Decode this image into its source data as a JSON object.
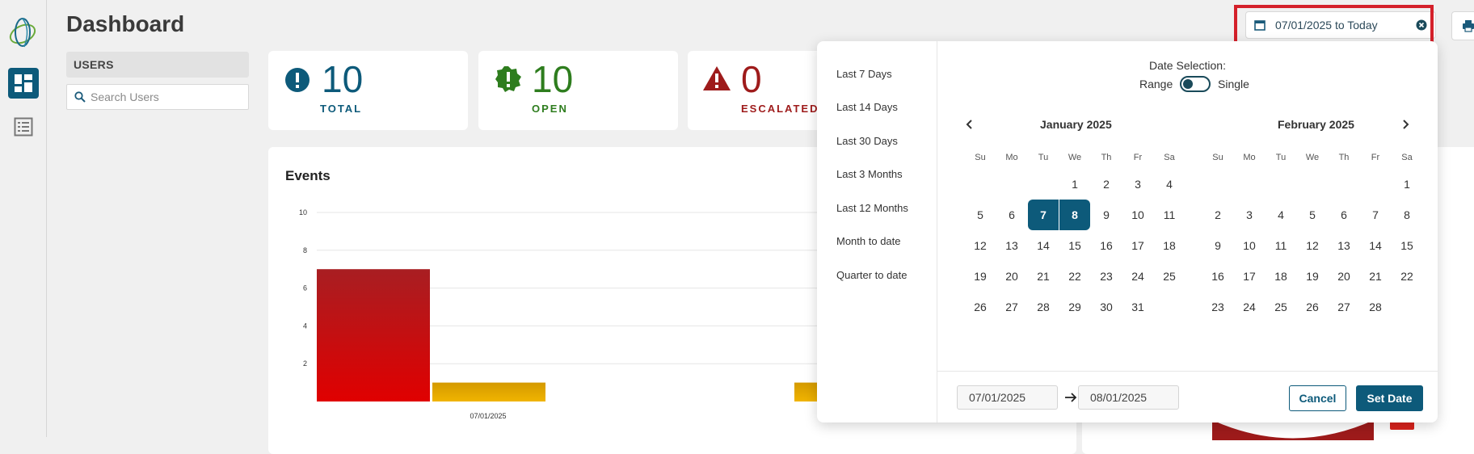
{
  "header": {
    "title": "Dashboard",
    "date_range": "07/01/2025 to Today"
  },
  "users": {
    "heading": "USERS",
    "search_placeholder": "Search Users"
  },
  "stats": [
    {
      "value": "10",
      "label": "TOTAL",
      "color": "#0d5a7a"
    },
    {
      "value": "10",
      "label": "OPEN",
      "color": "#2e7d1e"
    },
    {
      "value": "0",
      "label": "ESCALATED",
      "color": "#9e1b1b"
    }
  ],
  "events": {
    "title": "Events"
  },
  "chart_data": {
    "type": "bar",
    "title": "Events",
    "x": [
      "07/01/2025"
    ],
    "series": [
      {
        "values": [
          7
        ],
        "color": "#d40d0d"
      },
      {
        "values": [
          1
        ],
        "color": "#e8a800"
      },
      {
        "values": [
          1
        ],
        "color": "#e8a800"
      }
    ],
    "y_ticks": [
      "2",
      "4",
      "6",
      "8",
      "10"
    ],
    "ylim": [
      0,
      10
    ],
    "grid": true
  },
  "popup": {
    "presets": [
      "Last 7 Days",
      "Last 14 Days",
      "Last 30 Days",
      "Last 3 Months",
      "Last 12 Months",
      "Month to date",
      "Quarter to date"
    ],
    "selection_title": "Date Selection:",
    "range_label": "Range",
    "single_label": "Single",
    "weekdays": [
      "Su",
      "Mo",
      "Tu",
      "We",
      "Th",
      "Fr",
      "Sa"
    ],
    "months": [
      {
        "name": "January 2025",
        "start_offset": 3,
        "days": 31,
        "selected": [
          7,
          8
        ]
      },
      {
        "name": "February 2025",
        "start_offset": 6,
        "days": 28,
        "selected": []
      }
    ],
    "from_date": "07/01/2025",
    "to_date": "08/01/2025",
    "cancel": "Cancel",
    "set_date": "Set Date"
  }
}
